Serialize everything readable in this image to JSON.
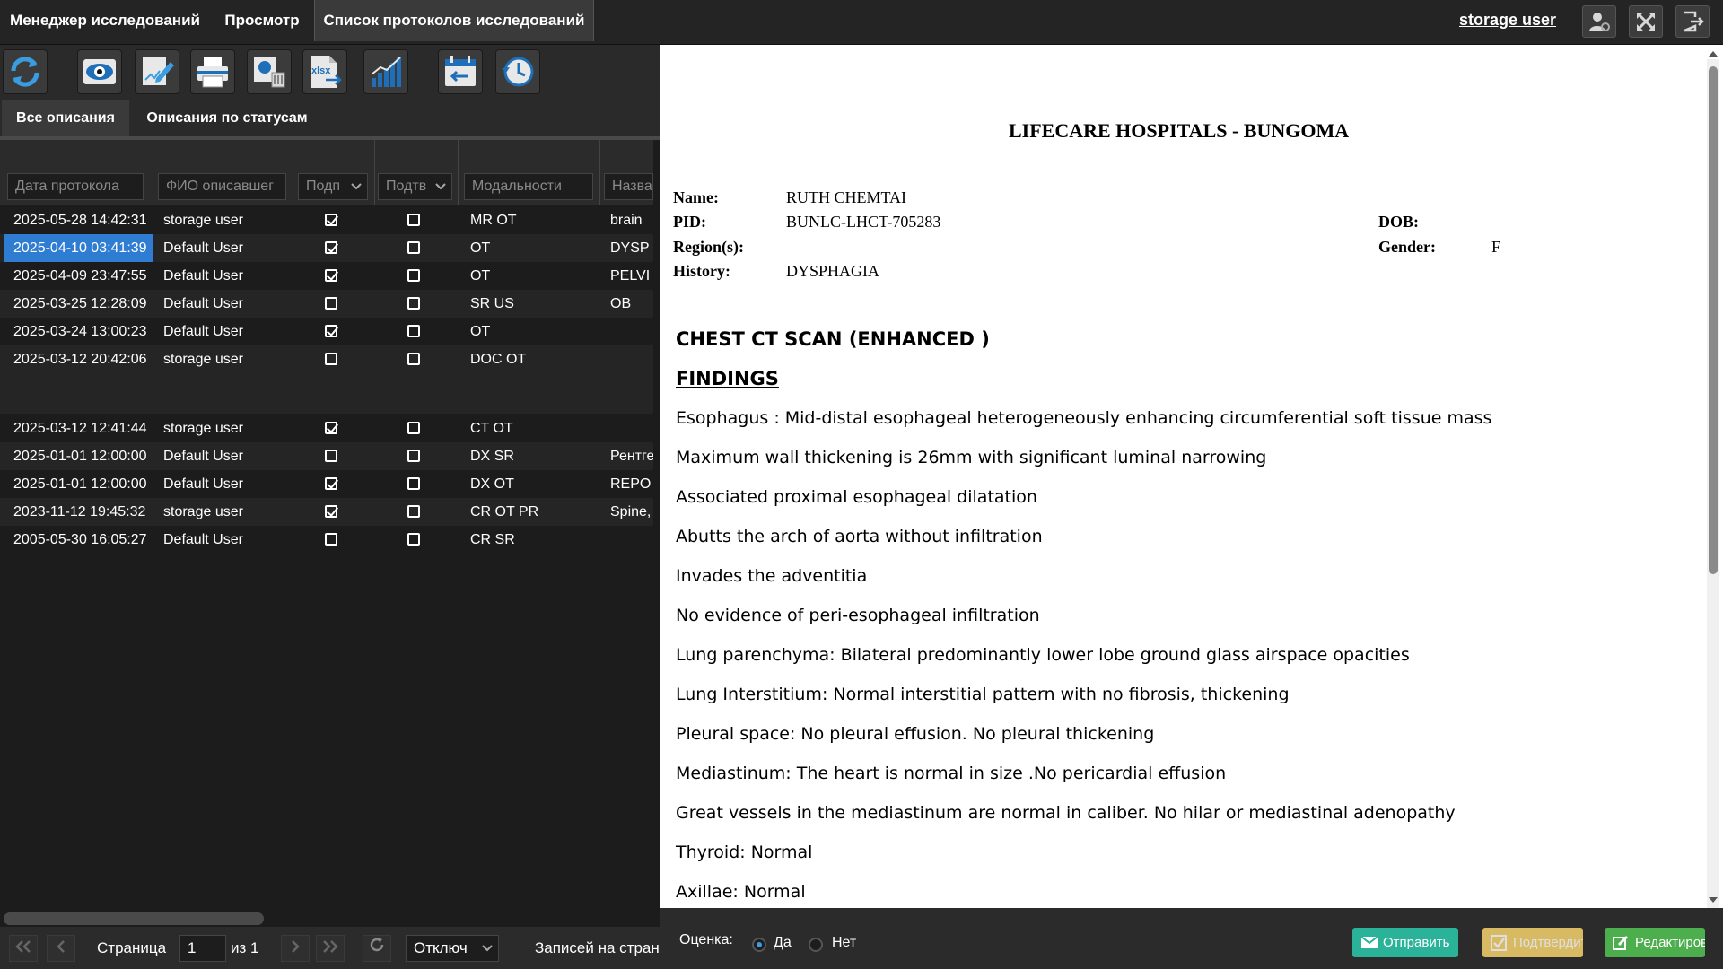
{
  "tabs": [
    {
      "label": "Менеджер исследований"
    },
    {
      "label": "Просмотр"
    },
    {
      "label": "Список протоколов исследований"
    }
  ],
  "user": {
    "name": "storage user"
  },
  "top_icons": [
    "user-settings-icon",
    "fullscreen-icon",
    "logout-icon"
  ],
  "toolbar_icons": [
    "refresh-icon",
    "view-eye-icon",
    "edit-sign-icon",
    "print-icon",
    "delete-report-icon",
    "export-xlsx-icon",
    "statistics-chart-icon",
    "calendar-back-icon",
    "history-clock-icon"
  ],
  "toolbar": {
    "xlsx_label": "xlsx"
  },
  "subtabs": [
    {
      "label": "Все описания"
    },
    {
      "label": "Описания по статусам"
    }
  ],
  "filters": {
    "date_placeholder": "Дата протокола",
    "name_placeholder": "ФИО описавшег",
    "signed_value": "Подп",
    "confirmed_value": "Подтв",
    "modality_placeholder": "Модальности",
    "title_placeholder": "Назва"
  },
  "rows": [
    {
      "date": "2025-05-28 14:42:31",
      "user": "storage user",
      "signed": true,
      "confirmed": false,
      "modality": "MR OT",
      "title": "brain"
    },
    {
      "date": "2025-04-10 03:41:39",
      "user": "Default User",
      "signed": true,
      "confirmed": false,
      "modality": "OT",
      "title": "DYSP",
      "selected": true
    },
    {
      "date": "2025-04-09 23:47:55",
      "user": "Default User",
      "signed": true,
      "confirmed": false,
      "modality": "OT",
      "title": "PELVI"
    },
    {
      "date": "2025-03-25 12:28:09",
      "user": "Default User",
      "signed": false,
      "confirmed": false,
      "modality": "SR US",
      "title": "OB"
    },
    {
      "date": "2025-03-24 13:00:23",
      "user": "Default User",
      "signed": true,
      "confirmed": false,
      "modality": "OT",
      "title": ""
    },
    {
      "date": "2025-03-12 20:42:06",
      "user": "storage user",
      "signed": false,
      "confirmed": false,
      "modality": "DOC OT",
      "title": ""
    },
    {
      "date": "2025-03-12 12:41:44",
      "user": "storage user",
      "signed": true,
      "confirmed": false,
      "modality": "CT OT",
      "title": ""
    },
    {
      "date": "2025-01-01 12:00:00",
      "user": "Default User",
      "signed": false,
      "confirmed": false,
      "modality": "DX SR",
      "title": "Рентге"
    },
    {
      "date": "2025-01-01 12:00:00",
      "user": "Default User",
      "signed": true,
      "confirmed": false,
      "modality": "DX OT",
      "title": "REPO"
    },
    {
      "date": "2023-11-12 19:45:32",
      "user": "storage user",
      "signed": true,
      "confirmed": false,
      "modality": "CR OT PR",
      "title": "Spine,"
    },
    {
      "date": "2005-05-30 16:05:27",
      "user": "Default User",
      "signed": false,
      "confirmed": false,
      "modality": "CR SR",
      "title": ""
    }
  ],
  "pager": {
    "page_label": "Страница",
    "page_value": "1",
    "of_label": "из 1",
    "auto_refresh_value": "Отключ",
    "records_label": "Записей на стран"
  },
  "report": {
    "hospital": "LIFECARE HOSPITALS - BUNGOMA",
    "name_label": "Name:",
    "name_value": "RUTH CHEMTAI",
    "pid_label": "PID:",
    "pid_value": "BUNLC-LHCT-705283",
    "regions_label": "Region(s):",
    "history_label": "History:",
    "history_value": "DYSPHAGIA",
    "dob_label": "DOB:",
    "gender_label": "Gender:",
    "gender_value": "F",
    "title": "CHEST CT SCAN  (ENHANCED )",
    "findings_heading": "FINDINGS",
    "lines": [
      "Esophagus : Mid-distal esophageal heterogeneously enhancing circumferential soft tissue mass",
      "Maximum wall thickening is 26mm with significant luminal narrowing",
      "Associated proximal esophageal dilatation",
      "Abutts the arch of aorta without infiltration",
      "Invades the adventitia",
      "No evidence of peri-esophageal infiltration",
      "Lung parenchyma: Bilateral predominantly lower lobe ground glass airspace opacities",
      "Lung Interstitium: Normal interstitial pattern with no fibrosis, thickening",
      "Pleural space: No pleural effusion. No pleural thickening",
      "Mediastinum: The heart is normal in size .No pericardial effusion",
      "Great vessels in the mediastinum are normal in caliber. No hilar or mediastinal adenopathy",
      "Thyroid: Normal",
      "Axillae: Normal"
    ]
  },
  "rating": {
    "label": "Оценка:",
    "yes": "Да",
    "no": "Нет",
    "selected": "yes"
  },
  "actions": {
    "send": "Отправить",
    "confirm": "Подтвердить",
    "edit": "Редактировать"
  },
  "colors": {
    "accent": "#2f7cd3",
    "send": "#2bb39a",
    "confirm": "#f5d36b",
    "edit": "#4cae4c"
  }
}
